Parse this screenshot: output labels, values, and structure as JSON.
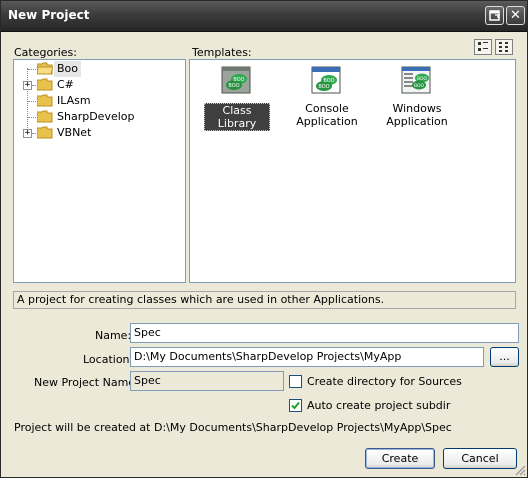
{
  "window": {
    "title": "New Project"
  },
  "categories": {
    "label": "Categories:",
    "items": [
      {
        "label": "Boo",
        "expandable": false,
        "selected": true
      },
      {
        "label": "C#",
        "expandable": true,
        "selected": false
      },
      {
        "label": "ILAsm",
        "expandable": false,
        "selected": false
      },
      {
        "label": "SharpDevelop",
        "expandable": false,
        "selected": false
      },
      {
        "label": "VBNet",
        "expandable": true,
        "selected": false
      }
    ]
  },
  "templates": {
    "label": "Templates:",
    "items": [
      {
        "label": "Class Library",
        "selected": true
      },
      {
        "label": "Console Application",
        "selected": false
      },
      {
        "label": "Windows Application",
        "selected": false
      }
    ]
  },
  "description": "A project for creating classes which are used in other Applications.",
  "form": {
    "name_label": "Name:",
    "name_value": "Spec",
    "location_label": "Location:",
    "location_value": "D:\\My Documents\\SharpDevelop Projects\\MyApp",
    "browse_label": "...",
    "project_name_label": "New Project Name:",
    "project_name_value": "Spec",
    "create_dir_label": "Create directory for Sources",
    "create_dir_checked": false,
    "auto_subdir_label": "Auto create project subdir",
    "auto_subdir_checked": true
  },
  "status_text": "Project will be created at D:\\My Documents\\SharpDevelop Projects\\MyApp\\Spec",
  "buttons": {
    "create": "Create",
    "cancel": "Cancel"
  },
  "colors": {
    "accent": "#316AC5",
    "window_bg": "#ECE9D8",
    "icon_green": "#2FA84F"
  }
}
